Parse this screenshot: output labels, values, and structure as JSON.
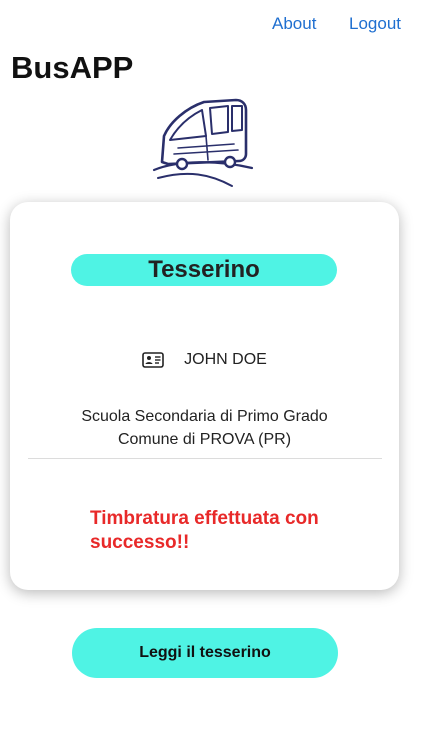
{
  "header": {
    "about_label": "About",
    "logout_label": "Logout",
    "app_title": "BusAPP"
  },
  "logo": {
    "icon": "bus-icon",
    "color": "#2a2f6b"
  },
  "card": {
    "title": "Tesserino",
    "holder_icon": "id-card-icon",
    "holder_name": "JOHN DOE",
    "school_name": "Scuola Secondaria di Primo Grado",
    "school_town": "Comune di PROVA (PR)",
    "status_message": "Timbratura effettuata con successo!!"
  },
  "actions": {
    "read_card_label": "Leggi il tesserino"
  },
  "colors": {
    "accent": "#4ff3e4",
    "link": "#1f6fd0",
    "success_status": "#e82929"
  }
}
